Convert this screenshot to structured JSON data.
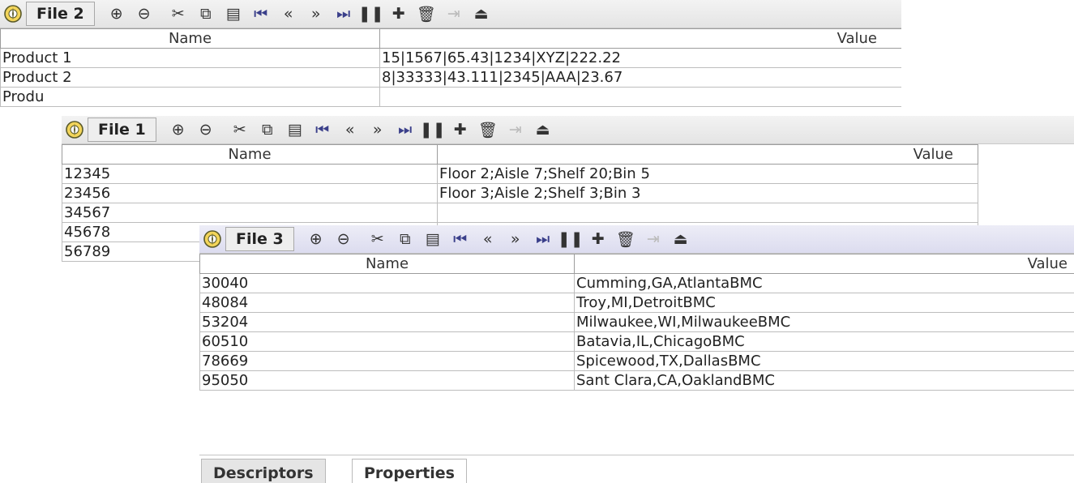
{
  "toolbar_icons": [
    "compass-icon",
    "zoom-in-icon",
    "zoom-out-icon",
    "cut-icon",
    "copy-icon",
    "paste-icon",
    "first-icon",
    "previous-icon",
    "next-icon",
    "last-icon",
    "pause-icon",
    "add-icon",
    "delete-icon",
    "export-icon",
    "import-icon"
  ],
  "file2": {
    "title": "File 2",
    "columns": {
      "name": "Name",
      "value": "Value"
    },
    "rows": [
      {
        "name": "Product 1",
        "value": "15|1567|65.43|1234|XYZ|222.22"
      },
      {
        "name": "Product 2",
        "value": "8|33333|43.111|2345|AAA|23.67"
      },
      {
        "name": "Produ",
        "value": ""
      }
    ]
  },
  "file1": {
    "title": "File 1",
    "columns": {
      "name": "Name",
      "value": "Value"
    },
    "rows": [
      {
        "name": "12345",
        "value": "Floor 2;Aisle 7;Shelf 20;Bin 5"
      },
      {
        "name": "23456",
        "value": "Floor 3;Aisle 2;Shelf 3;Bin 3"
      },
      {
        "name": "34567",
        "value": ""
      },
      {
        "name": "45678",
        "value": ""
      },
      {
        "name": "56789",
        "value": ""
      }
    ]
  },
  "file3": {
    "title": "File 3",
    "columns": {
      "name": "Name",
      "value": "Value"
    },
    "rows": [
      {
        "name": "30040",
        "value": "Cumming,GA,AtlantaBMC"
      },
      {
        "name": "48084",
        "value": "Troy,MI,DetroitBMC"
      },
      {
        "name": "53204",
        "value": "Milwaukee,WI,MilwaukeeBMC"
      },
      {
        "name": "60510",
        "value": "Batavia,IL,ChicagoBMC"
      },
      {
        "name": "78669",
        "value": "Spicewood,TX,DallasBMC"
      },
      {
        "name": "95050",
        "value": "Sant Clara,CA,OaklandBMC"
      }
    ],
    "bottom_tabs": {
      "descriptors": "Descriptors",
      "properties": "Properties"
    }
  }
}
